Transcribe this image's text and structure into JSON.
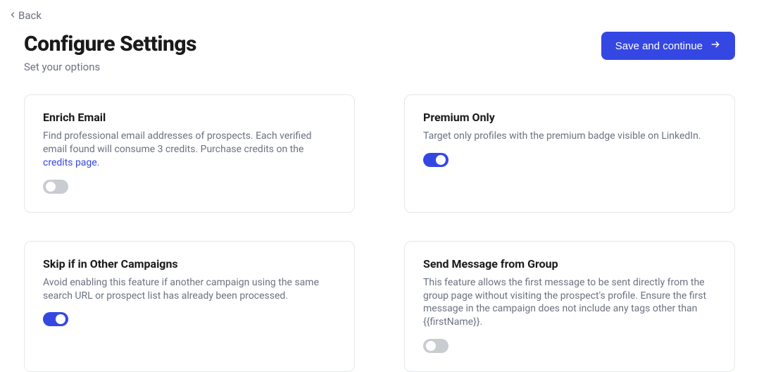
{
  "back_label": "Back",
  "header": {
    "title": "Configure Settings",
    "subtitle": "Set your options",
    "save_label": "Save and continue"
  },
  "cards": {
    "enrich_email": {
      "title": "Enrich Email",
      "desc_prefix": "Find professional email addresses of prospects. Each verified email found will consume 3 credits. Purchase credits on the ",
      "link_text": "credits page.",
      "toggle_on": false
    },
    "premium_only": {
      "title": "Premium Only",
      "desc": "Target only profiles with the premium badge visible on LinkedIn.",
      "toggle_on": true
    },
    "skip_other": {
      "title": "Skip if in Other Campaigns",
      "desc": "Avoid enabling this feature if another campaign using the same search URL or prospect list has already been processed.",
      "toggle_on": true
    },
    "send_from_group": {
      "title": "Send Message from Group",
      "desc": "This feature allows the first message to be sent directly from the group page without visiting the prospect's profile. Ensure the first message in the campaign does not include any tags other than {{firstName}}.",
      "toggle_on": false
    }
  }
}
